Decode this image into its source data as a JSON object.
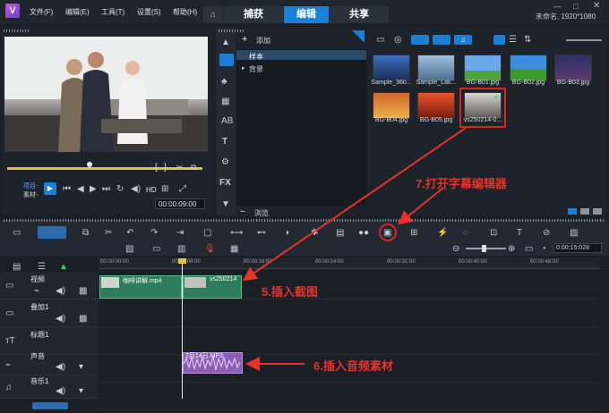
{
  "menu": [
    "文件(F)",
    "编辑(E)",
    "工具(T)",
    "设置(S)",
    "帮助(H)"
  ],
  "tabs": {
    "capture": "捕获",
    "edit": "编辑",
    "share": "共享"
  },
  "project_info": "未命名, 1920*1080",
  "player": {
    "mode_project": "项目-",
    "mode_clip": "素材-",
    "hd": "HD",
    "timecode": "00:00:09:00"
  },
  "library": {
    "add_label": "添加",
    "tree_items": [
      "样本",
      "背景"
    ],
    "browse_label": "浏览",
    "thumbnails": [
      "Sample_360...",
      "Sample_Lak...",
      "BG-B01.jpg",
      "BG-B02.jpg",
      "BG-B03.jpg",
      "BG-B04.jpg",
      "BG-B05.jpg",
      "vs250214-0..."
    ]
  },
  "timeline": {
    "ruler": [
      "00:00:00:00",
      "00:00:08:00",
      "00:00:16:00",
      "00:00:24:00",
      "00:00:32:00",
      "00:00:40:00",
      "00:00:48:00"
    ],
    "tracks": [
      "视频",
      "叠加1",
      "标题1",
      "声音",
      "音乐1"
    ],
    "clip_video1": "咖啡讲解.mp4",
    "clip_video2": "vs250214",
    "clip_audio": "2月14日.MP3",
    "zoom_timecode": "0:00:15:028"
  },
  "annotations": {
    "step5": "5.插入截图",
    "step6": "6.插入音频素材",
    "step7": "7.打开字幕编辑器"
  },
  "colors": {
    "accent_blue": "#1a7fd6",
    "annotation_red": "#e8322a"
  }
}
